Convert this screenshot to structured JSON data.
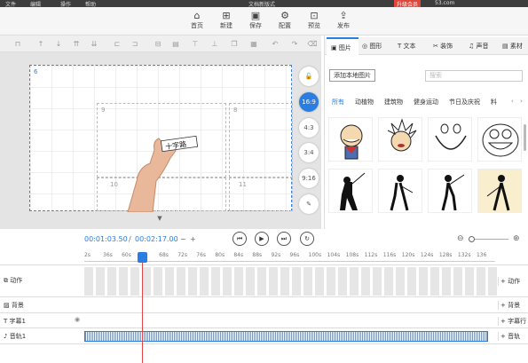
{
  "titlebar": {
    "menu": [
      "文件",
      "编辑",
      "操作",
      "帮助"
    ],
    "title": "文档新版式",
    "badge": "升级会员",
    "account": "53.com"
  },
  "toolbar": [
    {
      "icon": "home-icon",
      "label": "首页"
    },
    {
      "icon": "new-icon",
      "label": "新建"
    },
    {
      "icon": "save-icon",
      "label": "保存"
    },
    {
      "icon": "config-icon",
      "label": "配置"
    },
    {
      "icon": "preview-icon",
      "label": "预览"
    },
    {
      "icon": "publish-icon",
      "label": "发布"
    }
  ],
  "stage": {
    "frames": [
      "6",
      "9",
      "8",
      "10",
      "11"
    ],
    "handwriting": "十字路"
  },
  "right_tools": [
    "16:9",
    "4:3",
    "3:4",
    "9:16"
  ],
  "panel": {
    "tabs": [
      "图片",
      "图形",
      "文本",
      "装饰",
      "声音",
      "素材"
    ],
    "add_local": "添加本地图片",
    "search_placeholder": "搜索",
    "categories": [
      "所有",
      "动植物",
      "建筑物",
      "健身运动",
      "节日及庆祝",
      "料"
    ]
  },
  "timeline": {
    "current": "00:01:03.50",
    "separator": "/",
    "total": "00:02:17.00",
    "ruler": [
      "2s",
      "36s",
      "60s",
      "1",
      "68s",
      "72s",
      "76s",
      "80s",
      "84s",
      "88s",
      "92s",
      "96s",
      "100s",
      "104s",
      "108s",
      "112s",
      "116s",
      "120s",
      "124s",
      "128s",
      "132s",
      "136"
    ],
    "tracks": [
      {
        "label": "动作",
        "add": "+ 动作"
      },
      {
        "label": "背景",
        "add": "+ 背景"
      },
      {
        "label": "字幕1",
        "add": "+ 字幕行"
      },
      {
        "label": "音轨1",
        "add": "+ 音轨"
      }
    ]
  }
}
